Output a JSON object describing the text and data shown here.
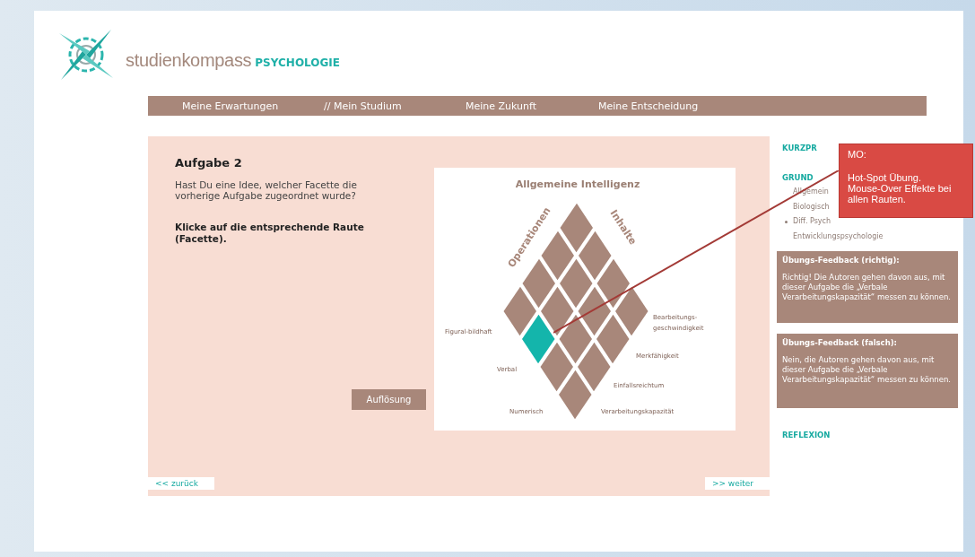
{
  "header": {
    "brand": "studienkompass",
    "brand_suffix": "PSYCHOLOGIE"
  },
  "nav": [
    {
      "label": "Meine Erwartungen"
    },
    {
      "label": "// Mein Studium"
    },
    {
      "label": "Meine Zukunft"
    },
    {
      "label": "Meine Entscheidung"
    }
  ],
  "task": {
    "title": "Aufgabe 2",
    "question": "Hast Du eine Idee, welcher Facette die vorherige Aufgabe zugeordnet wurde?",
    "instruction": "Klicke auf die entsprechende Raute (Facette).",
    "button": "Auflösung"
  },
  "figure": {
    "title": "Allgemeine Intelligenz",
    "axis_left": "Operationen",
    "axis_right": "Inhalte",
    "content_labels": [
      "Figural-bildhaft",
      "Verbal",
      "Numerisch"
    ],
    "operation_labels": [
      "Bearbeitungs-\ngeschwindigkeit",
      "Merkfähigkeit",
      "Einfallsreichtum",
      "Verarbeitungskapazität"
    ],
    "cells": [
      [
        {
          "selected": false
        },
        {
          "selected": false
        },
        {
          "selected": false
        },
        {
          "selected": false
        }
      ],
      [
        {
          "selected": false
        },
        {
          "selected": false
        },
        {
          "selected": false
        },
        {
          "selected": true
        }
      ],
      [
        {
          "selected": false
        },
        {
          "selected": false
        },
        {
          "selected": false
        },
        {
          "selected": false
        }
      ],
      [
        {
          "selected": false
        },
        {
          "selected": false
        },
        {
          "selected": false
        },
        {
          "selected": false
        }
      ]
    ]
  },
  "pager": {
    "back": "<< zurück",
    "next": ">> weiter"
  },
  "sidebar": [
    {
      "kind": "heading",
      "label": "KURZPR"
    },
    {
      "kind": "heading",
      "label": "GRUND"
    },
    {
      "kind": "item",
      "label": "Allgemein"
    },
    {
      "kind": "item",
      "label": "Biologisch"
    },
    {
      "kind": "bullet",
      "label": "Diff. Psych"
    },
    {
      "kind": "item",
      "label": "Entwicklungspsychologie"
    },
    {
      "kind": "gap"
    },
    {
      "kind": "heading",
      "label": "REFLEXION"
    }
  ],
  "note": {
    "title": "MO:",
    "text": "Hot-Spot Übung. Mouse-Over Effekte bei allen Rauten."
  },
  "feedback": [
    {
      "title": "Übungs-Feedback (richtig):",
      "text": "Richtig! Die Autoren gehen davon aus, mit dieser Aufgabe die „Verbale Verarbeitungskapazität“ messen zu können."
    },
    {
      "title": "Übungs-Feedback (falsch):",
      "text": "Nein, die Autoren gehen davon aus, mit dieser Aufgabe die „Verbale Verarbeitungskapazität“ messen zu können."
    }
  ]
}
